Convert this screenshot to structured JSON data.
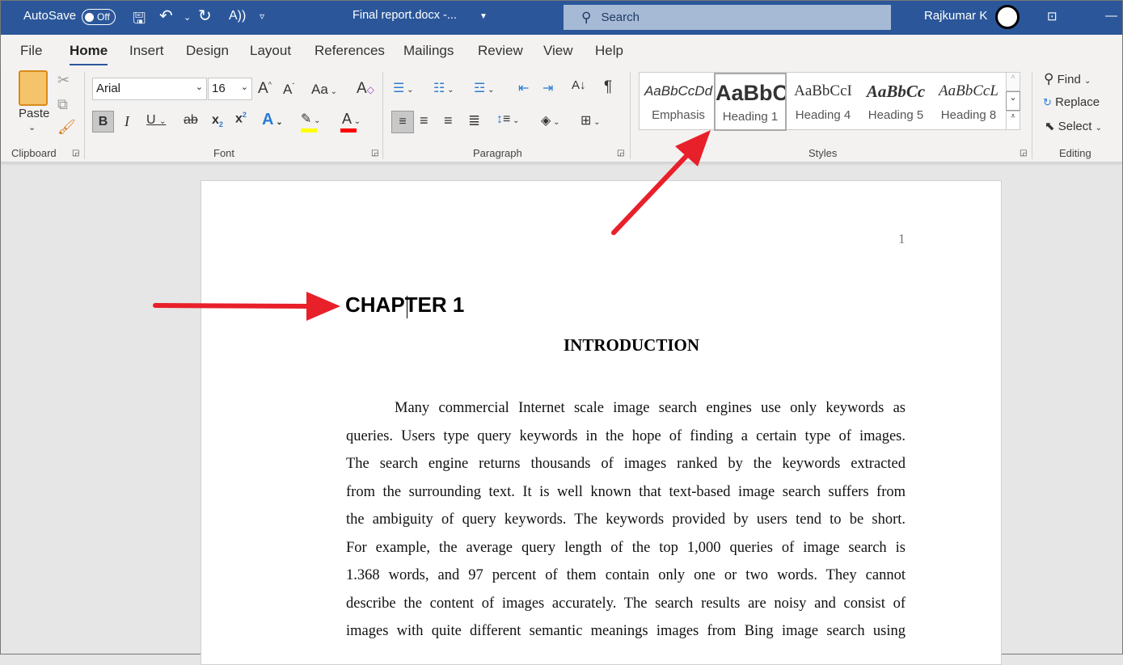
{
  "titlebar": {
    "autosave": "AutoSave",
    "autosave_state": "Off",
    "doc_title": "Final report.docx  -...",
    "search_placeholder": "Search",
    "user": "Rajkumar K"
  },
  "tabs": [
    "File",
    "Home",
    "Insert",
    "Design",
    "Layout",
    "References",
    "Mailings",
    "Review",
    "View",
    "Help"
  ],
  "active_tab": "Home",
  "ribbon": {
    "clipboard": {
      "label": "Clipboard",
      "paste": "Paste"
    },
    "font": {
      "label": "Font",
      "font_name": "Arial",
      "font_size": "16",
      "case_label": "Aa"
    },
    "paragraph": {
      "label": "Paragraph"
    },
    "styles": {
      "label": "Styles",
      "items": [
        {
          "preview": "AaBbCcDd",
          "name": "Emphasis"
        },
        {
          "preview": "AaBbC",
          "name": "Heading 1",
          "selected": true
        },
        {
          "preview": "AaBbCcI",
          "name": "Heading 4"
        },
        {
          "preview": "AaBbCc",
          "name": "Heading 5"
        },
        {
          "preview": "AaBbCcL",
          "name": "Heading 8"
        }
      ]
    },
    "editing": {
      "label": "Editing",
      "find": "Find",
      "replace": "Replace",
      "select": "Select"
    }
  },
  "colors": {
    "accent": "#2b579a",
    "highlight": "#ffff00",
    "font_color": "#ff0000",
    "arrow": "#e8202a"
  },
  "document": {
    "page_number": "1",
    "chapter": "CHAPTER 1",
    "title": "INTRODUCTION",
    "lines": [
      "Many commercial Internet scale image search engines use only keywords as",
      "queries. Users type query keywords in the hope of finding a certain type of images.",
      "The search engine returns thousands of images ranked by the keywords extracted",
      "from the surrounding text. It is well known that text-based image search suffers from",
      "the ambiguity of query keywords. The keywords provided by users tend to be short.",
      "For example, the average query length of the top 1,000 queries of image search is",
      "1.368 words, and 97 percent of them contain only one or two words. They cannot",
      "describe the content of images accurately. The search results are noisy and consist of",
      "images with quite different semantic meanings images from Bing image search using"
    ]
  }
}
